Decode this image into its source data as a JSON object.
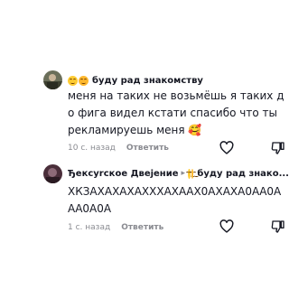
{
  "comments": [
    {
      "author": "",
      "reply_to": "буду рад знакомству",
      "text": "меня на таких не возьмёшь я таких до фига видел кстати спасибо что ты рекламируешь меня 🥰",
      "time": "10 с. назад",
      "reply_label": "Ответить"
    },
    {
      "author": "Ђекcуrcкое Двеjение",
      "reply_to": "буду рад знако...",
      "text": "ХКЗАХАХАХАХХХАХААХ0АХАХА0АА0ААА0А0А",
      "time": "1 с. назад",
      "reply_label": "Ответить"
    }
  ],
  "colors": {
    "text": "#161823",
    "secondary": "#8a8b91",
    "emoji": "#ffcc33"
  },
  "icons": {
    "like": "heart-outline-icon",
    "dislike": "thumbs-down-outline-icon",
    "reply_arrow": "reply-arrow-icon"
  }
}
